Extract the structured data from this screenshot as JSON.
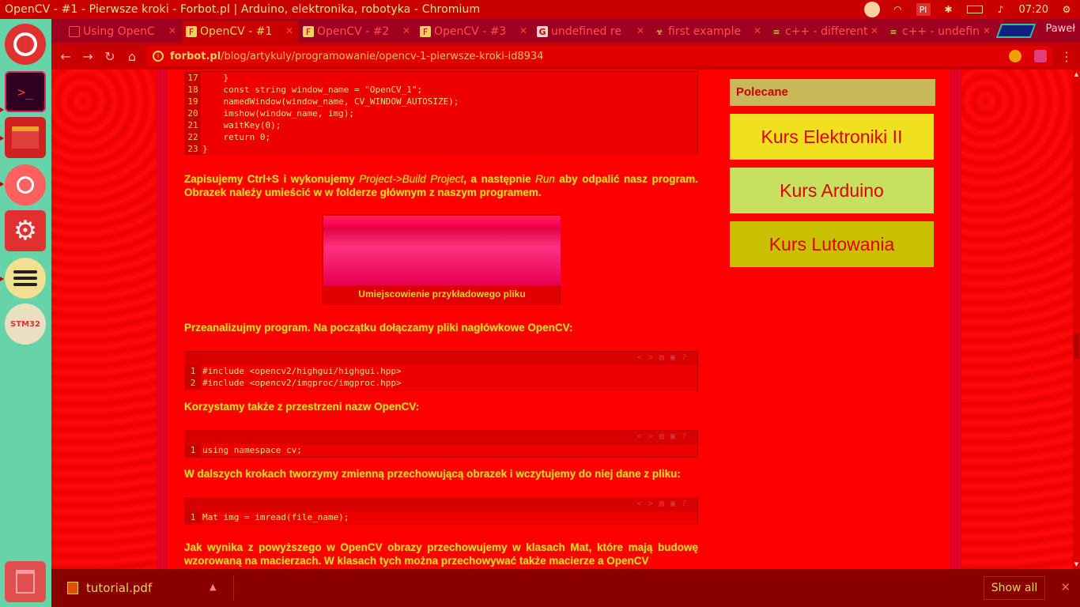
{
  "window": {
    "title": "OpenCV - #1 - Pierwsze kroki - Forbot.pl | Arduino, elektronika, robotyka - Chromium"
  },
  "tray": {
    "lang": "Pl",
    "clock": "07:20"
  },
  "tabs": [
    {
      "label": "Using OpenC",
      "favicon": "page-icon"
    },
    {
      "label": "OpenCV - #1",
      "favicon": "forbot-icon"
    },
    {
      "label": "OpenCV - #2",
      "favicon": "forbot-icon"
    },
    {
      "label": "OpenCV - #3",
      "favicon": "forbot-icon"
    },
    {
      "label": "undefined re",
      "favicon": "google-icon"
    },
    {
      "label": "first example",
      "favicon": "biohazard-icon"
    },
    {
      "label": "c++ - different",
      "favicon": "stackoverflow-icon"
    },
    {
      "label": "c++ - undefin",
      "favicon": "stackoverflow-icon"
    }
  ],
  "profile": "Paweł",
  "omnibox": {
    "host": "forbot.pl",
    "path": "/blog/artykuly/programowanie/opencv-1-pierwsze-kroki-id8934"
  },
  "code1": {
    "lines": [
      {
        "n": "17",
        "t": "    }"
      },
      {
        "n": "18",
        "t": "    const string window_name = \"OpenCV_1\";"
      },
      {
        "n": "19",
        "t": "    namedWindow(window_name, CV_WINDOW_AUTOSIZE);"
      },
      {
        "n": "20",
        "t": "    imshow(window_name, img);"
      },
      {
        "n": "21",
        "t": "    waitKey(0);"
      },
      {
        "n": "22",
        "t": "    return 0;"
      },
      {
        "n": "23",
        "t": "}"
      }
    ]
  },
  "para1": {
    "a": "Zapisujemy Ctrl+S i wykonujemy ",
    "b": "Project->Build Project",
    "c": ", a następnie ",
    "d": "Run",
    "e": " aby odpalić nasz program. Obrazek należy umieścić w w folderze głównym z naszym programem."
  },
  "figure": {
    "caption": "Umiejscowienie przykładowego pliku"
  },
  "para2": "Przeanalizujmy program. Na początku dołączamy pliki nagłówkowe OpenCV:",
  "code2": {
    "lines": [
      {
        "n": "1",
        "t": "#include <opencv2/highgui/highgui.hpp>"
      },
      {
        "n": "2",
        "t": "#include <opencv2/imgproc/imgproc.hpp>"
      }
    ]
  },
  "para3": "Korzystamy także z przestrzeni nazw OpenCV:",
  "code3": {
    "lines": [
      {
        "n": "1",
        "t": "using namespace cv;"
      }
    ]
  },
  "para4": "W dalszych krokach tworzymy zmienną przechowującą obrazek i wczytujemy do niej dane z pliku:",
  "code4": {
    "lines": [
      {
        "n": "1",
        "t": "Mat img = imread(file_name);"
      }
    ]
  },
  "para5": "Jak wynika z powyższego w OpenCV obrazy przechowujemy w klasach Mat, które mają budowę wzorowaną na macierzach. W klasach tych można przechowywać także macierze a OpenCV",
  "sidebar": {
    "heading": "Polecane",
    "buttons": [
      {
        "label": "Kurs Elektroniki II",
        "bg": "#f0e020"
      },
      {
        "label": "Kurs Arduino",
        "bg": "#c8e060"
      },
      {
        "label": "Kurs Lutowania",
        "bg": "#c8c000"
      }
    ]
  },
  "downloads": {
    "file": "tutorial.pdf",
    "show_all": "Show all"
  },
  "launcher": [
    "ubuntu-dash-icon",
    "terminal-icon",
    "files-icon",
    "chromium-icon",
    "settings-icon",
    "spotify-icon",
    "stm32-tools-icon",
    "trash-icon"
  ]
}
